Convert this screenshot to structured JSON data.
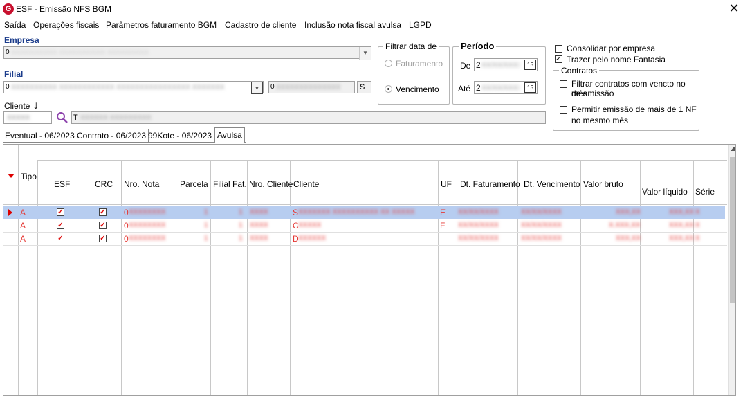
{
  "window": {
    "title": "ESF - Emissão NFS BGM",
    "close_glyph": "✕"
  },
  "menu": [
    "Saída",
    "Operações fiscais",
    "Parâmetros faturamento BGM",
    "Cadastro de cliente",
    "Inclusão nota fiscal avulsa",
    "LGPD"
  ],
  "empresa": {
    "label": "Empresa",
    "value": "0"
  },
  "filial": {
    "label": "Filial",
    "value": "0",
    "code_value": "0",
    "small_value": "S"
  },
  "cliente": {
    "label": "Cliente ⇓",
    "code_value": "",
    "name_value": "T"
  },
  "filtrar": {
    "caption": "Filtrar data de",
    "opt1": "Faturamento",
    "opt2": "Vencimento",
    "selected": "Vencimento"
  },
  "periodo": {
    "caption": "Período",
    "de_label": "De",
    "de_value": "2",
    "ate_label": "Até",
    "ate_value": "2",
    "cal_glyph": "15"
  },
  "options": {
    "consolidar": "Consolidar por empresa",
    "trazer": "Trazer pelo nome Fantasia",
    "trazer_checked": true,
    "consolidar_checked": false
  },
  "contratos": {
    "caption": "Contratos",
    "opt1_line1": "Filtrar contratos com vencto no mês",
    "opt1_line2": "de emissão",
    "opt2_line1": "Permitir emissão de mais de 1 NF",
    "opt2_line2": "no mesmo mês"
  },
  "tabs": [
    "Eventual - 06/2023",
    "Contrato - 06/2023",
    "99Kote   - 06/2023",
    "Avulsa"
  ],
  "active_tab": "Avulsa",
  "grid": {
    "headers": {
      "tipo": "Tipo",
      "esf": "ESF",
      "crc": "CRC",
      "nro_nota": "Nro. Nota",
      "parcela": "Parcela",
      "filial_fat": "Filial Fat.",
      "nro_cliente": "Nro. Cliente",
      "cliente": "Cliente",
      "uf": "UF",
      "dt_faturamento": "Dt. Faturamento",
      "dt_vencimento": "Dt. Vencimento",
      "valor_bruto": "Valor bruto",
      "valor_liquido": "Valor líquido",
      "serie": "Série"
    },
    "rows": [
      {
        "tipo": "A",
        "nota": "0",
        "filial": "1",
        "cliente_no": "1",
        "cliente": "S",
        "uf": "E",
        "selected": true
      },
      {
        "tipo": "A",
        "nota": "0",
        "filial": "1",
        "cliente_no": "1",
        "cliente": "C",
        "uf": "F",
        "selected": false
      },
      {
        "tipo": "A",
        "nota": "0",
        "filial": "1",
        "cliente_no": "1",
        "cliente": "D",
        "uf": "",
        "selected": false
      }
    ]
  }
}
